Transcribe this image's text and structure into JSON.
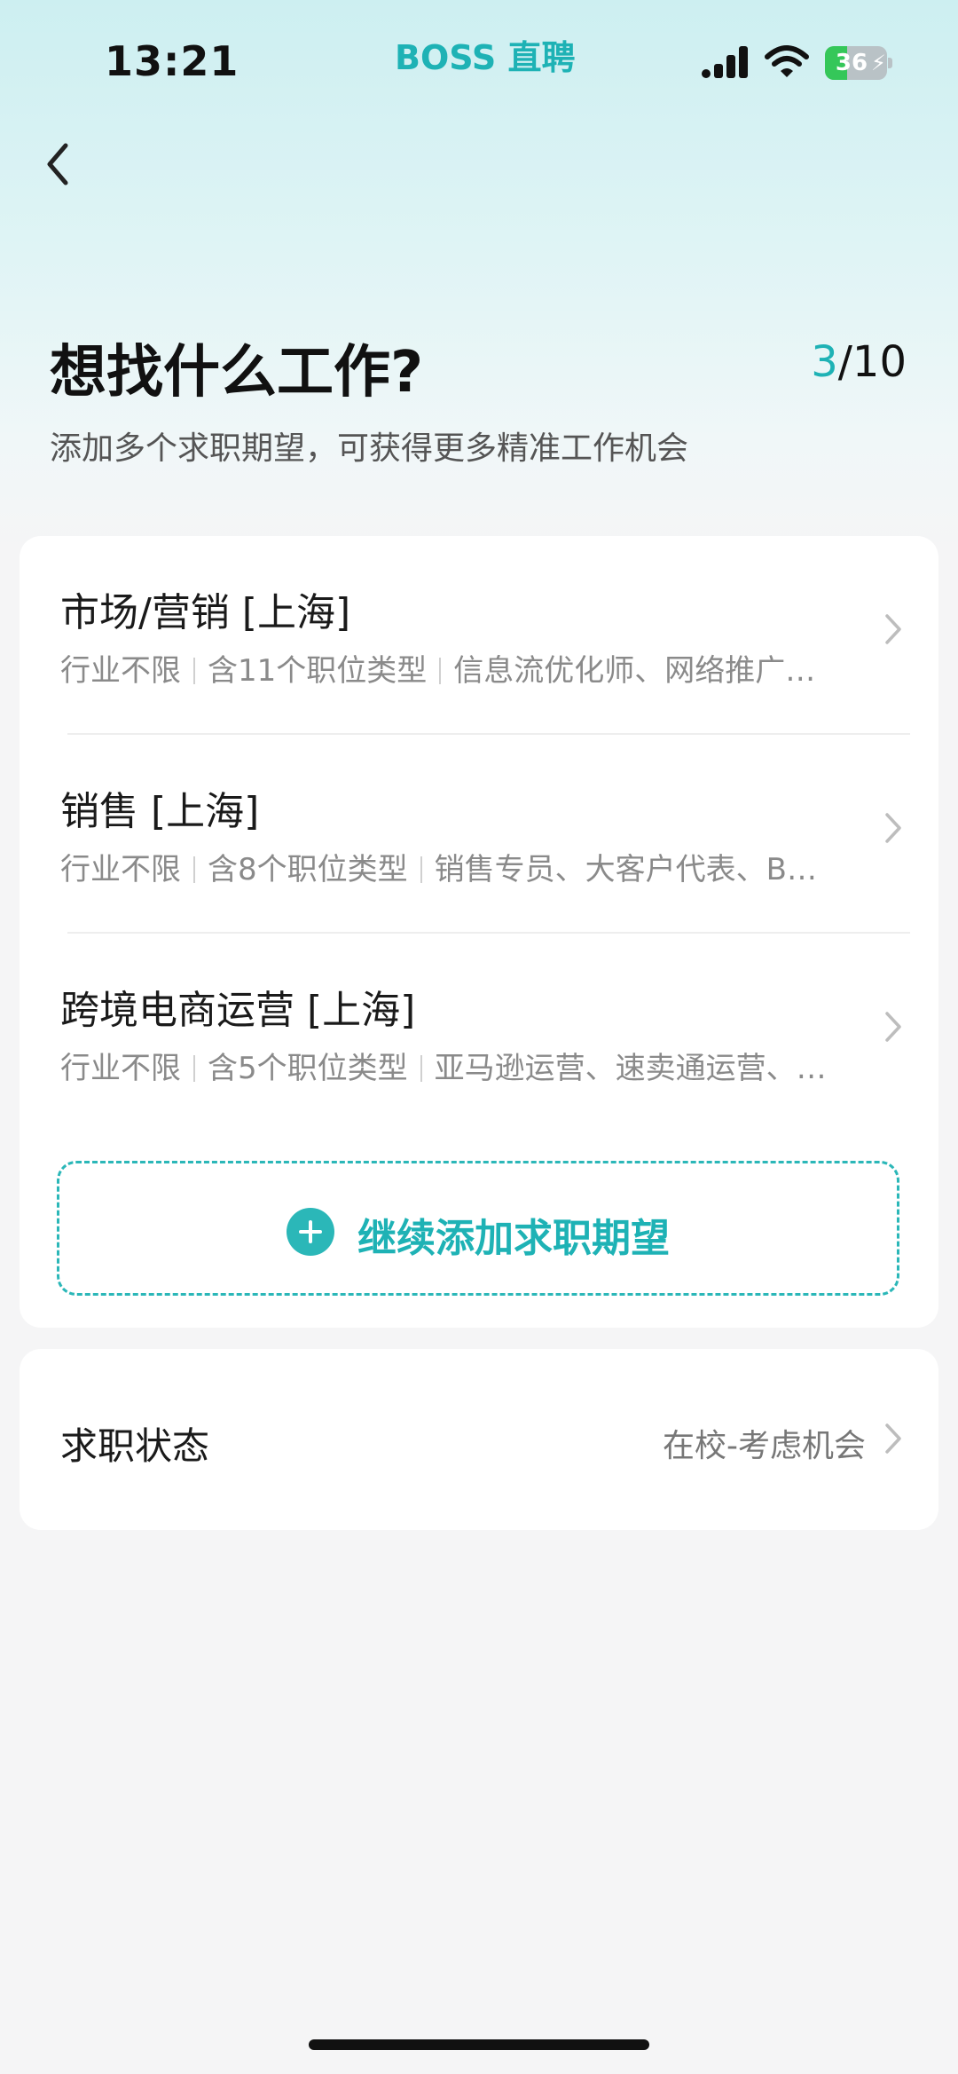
{
  "status_bar": {
    "time": "13:21",
    "app_name": "BOSS 直聘",
    "battery_level": "36",
    "battery_fraction": 0.36,
    "signal_icon": "cellular-signal-icon",
    "wifi_icon": "wifi-icon",
    "battery_icon": "battery-charging-icon"
  },
  "nav": {
    "back_icon": "chevron-left-icon"
  },
  "header": {
    "title": "想找什么工作?",
    "progress_current": "3",
    "progress_total": "/10",
    "subtitle": "添加多个求职期望，可获得更多精准工作机会"
  },
  "expectations": [
    {
      "title": "市场/营销 [上海]",
      "industry": "行业不限",
      "count": "含11个职位类型",
      "roles": "信息流优化师、网络推广…"
    },
    {
      "title": "销售 [上海]",
      "industry": "行业不限",
      "count": "含8个职位类型",
      "roles": "销售专员、大客户代表、B…"
    },
    {
      "title": "跨境电商运营 [上海]",
      "industry": "行业不限",
      "count": "含5个职位类型",
      "roles": "亚马逊运营、速卖通运营、…"
    }
  ],
  "add_button": {
    "label": "继续添加求职期望",
    "icon": "plus-circle-icon"
  },
  "job_status": {
    "label": "求职状态",
    "value": "在校-考虑机会"
  },
  "colors": {
    "accent": "#1eb2b5",
    "battery_green": "#35c759",
    "background": "#f5f5f6"
  }
}
